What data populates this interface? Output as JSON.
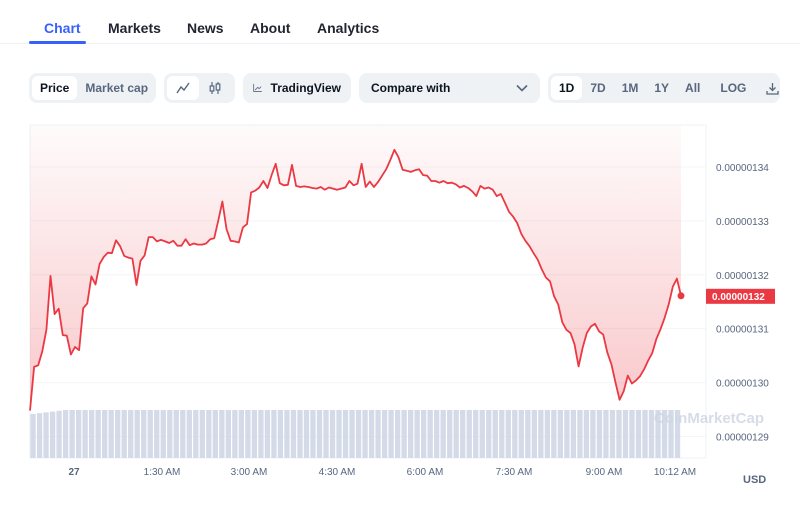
{
  "tabs": [
    {
      "label": "Chart",
      "active": true
    },
    {
      "label": "Markets",
      "active": false
    },
    {
      "label": "News",
      "active": false
    },
    {
      "label": "About",
      "active": false
    },
    {
      "label": "Analytics",
      "active": false
    }
  ],
  "toolbar": {
    "type_toggle": [
      "Price",
      "Market cap"
    ],
    "type_active": "Price",
    "chart_style": [
      {
        "icon": "line-chart-icon"
      },
      {
        "icon": "candlestick-icon"
      }
    ],
    "tradingview_label": "TradingView",
    "compare_label": "Compare with",
    "ranges": [
      "1D",
      "7D",
      "1M",
      "1Y",
      "All"
    ],
    "range_active": "1D",
    "log_label": "LOG",
    "download_icon": "download-icon"
  },
  "currency": "USD",
  "watermark": "CoinMarketCap",
  "colors": {
    "accent": "#3861fb",
    "line": "#ea3943",
    "volume": "#cfd6e4"
  },
  "chart_data": {
    "type": "line",
    "title": "",
    "xlabel": "",
    "ylabel": "",
    "x_tick_labels": [
      "27",
      "1:30 AM",
      "3:00 AM",
      "4:30 AM",
      "6:00 AM",
      "7:30 AM",
      "9:00 AM",
      "10:12 AM"
    ],
    "y_tick_labels": [
      "0.00000134",
      "0.00000133",
      "0.00000132",
      "0.00000131",
      "0.00000130",
      "0.00000129"
    ],
    "y_ticks": [
      1.34,
      1.33,
      1.32,
      1.31,
      1.3,
      1.29
    ],
    "y_unit_note": "values in 1e-6 USD",
    "ylim": [
      1.286,
      1.3478
    ],
    "current_price_label": "0.00000132",
    "current_price": 1.3161,
    "grid": true,
    "series": [
      {
        "name": "Price",
        "values": [
          1.2948,
          1.3029,
          1.3032,
          1.3058,
          1.3098,
          1.3198,
          1.3127,
          1.3137,
          1.3088,
          1.3087,
          1.3052,
          1.3066,
          1.306,
          1.3138,
          1.3147,
          1.3197,
          1.3182,
          1.322,
          1.3233,
          1.3241,
          1.324,
          1.3264,
          1.3253,
          1.3235,
          1.3232,
          1.323,
          1.3181,
          1.3226,
          1.3236,
          1.327,
          1.327,
          1.3262,
          1.3265,
          1.3262,
          1.3259,
          1.3263,
          1.3254,
          1.3254,
          1.3266,
          1.3255,
          1.3258,
          1.3256,
          1.3256,
          1.3258,
          1.3266,
          1.3268,
          1.3301,
          1.3336,
          1.3285,
          1.3263,
          1.3262,
          1.326,
          1.3288,
          1.3294,
          1.3353,
          1.3356,
          1.3362,
          1.3374,
          1.3361,
          1.3385,
          1.3406,
          1.337,
          1.3366,
          1.3367,
          1.3404,
          1.3365,
          1.3363,
          1.3364,
          1.3363,
          1.3361,
          1.336,
          1.3363,
          1.3358,
          1.3362,
          1.336,
          1.3358,
          1.336,
          1.3362,
          1.3374,
          1.3366,
          1.3369,
          1.3406,
          1.3363,
          1.3373,
          1.3363,
          1.3372,
          1.3384,
          1.3396,
          1.3413,
          1.3432,
          1.3418,
          1.3395,
          1.3393,
          1.3391,
          1.3394,
          1.3396,
          1.3385,
          1.3384,
          1.3374,
          1.3374,
          1.3371,
          1.3374,
          1.337,
          1.3371,
          1.3368,
          1.3362,
          1.3365,
          1.3361,
          1.3355,
          1.3346,
          1.3365,
          1.336,
          1.3362,
          1.3358,
          1.3346,
          1.335,
          1.3334,
          1.3317,
          1.3308,
          1.3296,
          1.3276,
          1.3263,
          1.3253,
          1.324,
          1.3228,
          1.321,
          1.3195,
          1.3188,
          1.316,
          1.3145,
          1.3112,
          1.3098,
          1.3092,
          1.3071,
          1.303,
          1.3065,
          1.3092,
          1.3104,
          1.3109,
          1.3095,
          1.3089,
          1.3056,
          1.3034,
          1.3,
          1.2968,
          1.2984,
          1.3013,
          1.2998,
          1.3004,
          1.3012,
          1.3025,
          1.3041,
          1.3055,
          1.3081,
          1.3099,
          1.312,
          1.3145,
          1.3178,
          1.3193,
          1.3161
        ]
      }
    ],
    "volume_bars": 100
  }
}
